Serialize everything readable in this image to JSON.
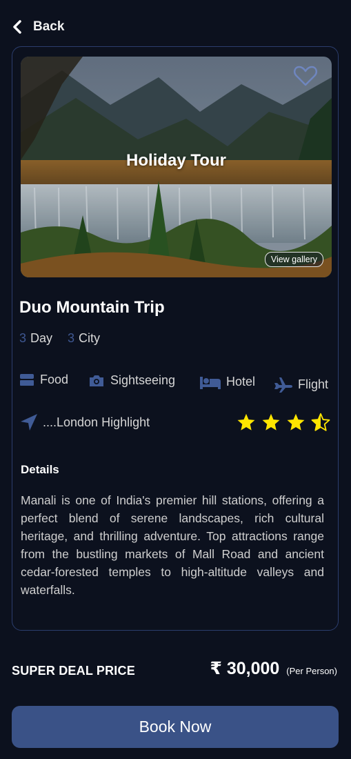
{
  "header": {
    "back_label": "Back"
  },
  "hero": {
    "overlay_title": "Holiday Tour",
    "gallery_label": "View gallery",
    "favorite_icon": "heart-outline-icon"
  },
  "trip": {
    "title": "Duo Mountain Trip",
    "days_num": "3",
    "days_label": "Day",
    "cities_num": "3",
    "cities_label": "City"
  },
  "amenities": [
    {
      "icon": "food-icon",
      "label": "Food"
    },
    {
      "icon": "camera-icon",
      "label": "Sightseeing"
    },
    {
      "icon": "bed-icon",
      "label": "Hotel"
    },
    {
      "icon": "plane-icon",
      "label": "Flight"
    }
  ],
  "highlight": {
    "icon": "navigation-arrow-icon",
    "text": "....London Highlight"
  },
  "rating": {
    "value": 3.5,
    "max": 4
  },
  "details": {
    "heading": "Details",
    "text": "Manali is one of India's premier hill stations, offering a perfect blend of serene landscapes, rich cultural heritage, and thrilling adventure. Top attractions range from the bustling markets of Mall Road and ancient cedar-forested temples to high-altitude valleys and waterfalls."
  },
  "price": {
    "label": "SUPER DEAL PRICE",
    "value": "₹  30,000",
    "unit": "(Per Person)"
  },
  "cta": {
    "label": "Book Now"
  },
  "colors": {
    "background": "#0c111e",
    "accent": "#3a5287",
    "icon": "#405b96",
    "star": "#ffe500"
  }
}
